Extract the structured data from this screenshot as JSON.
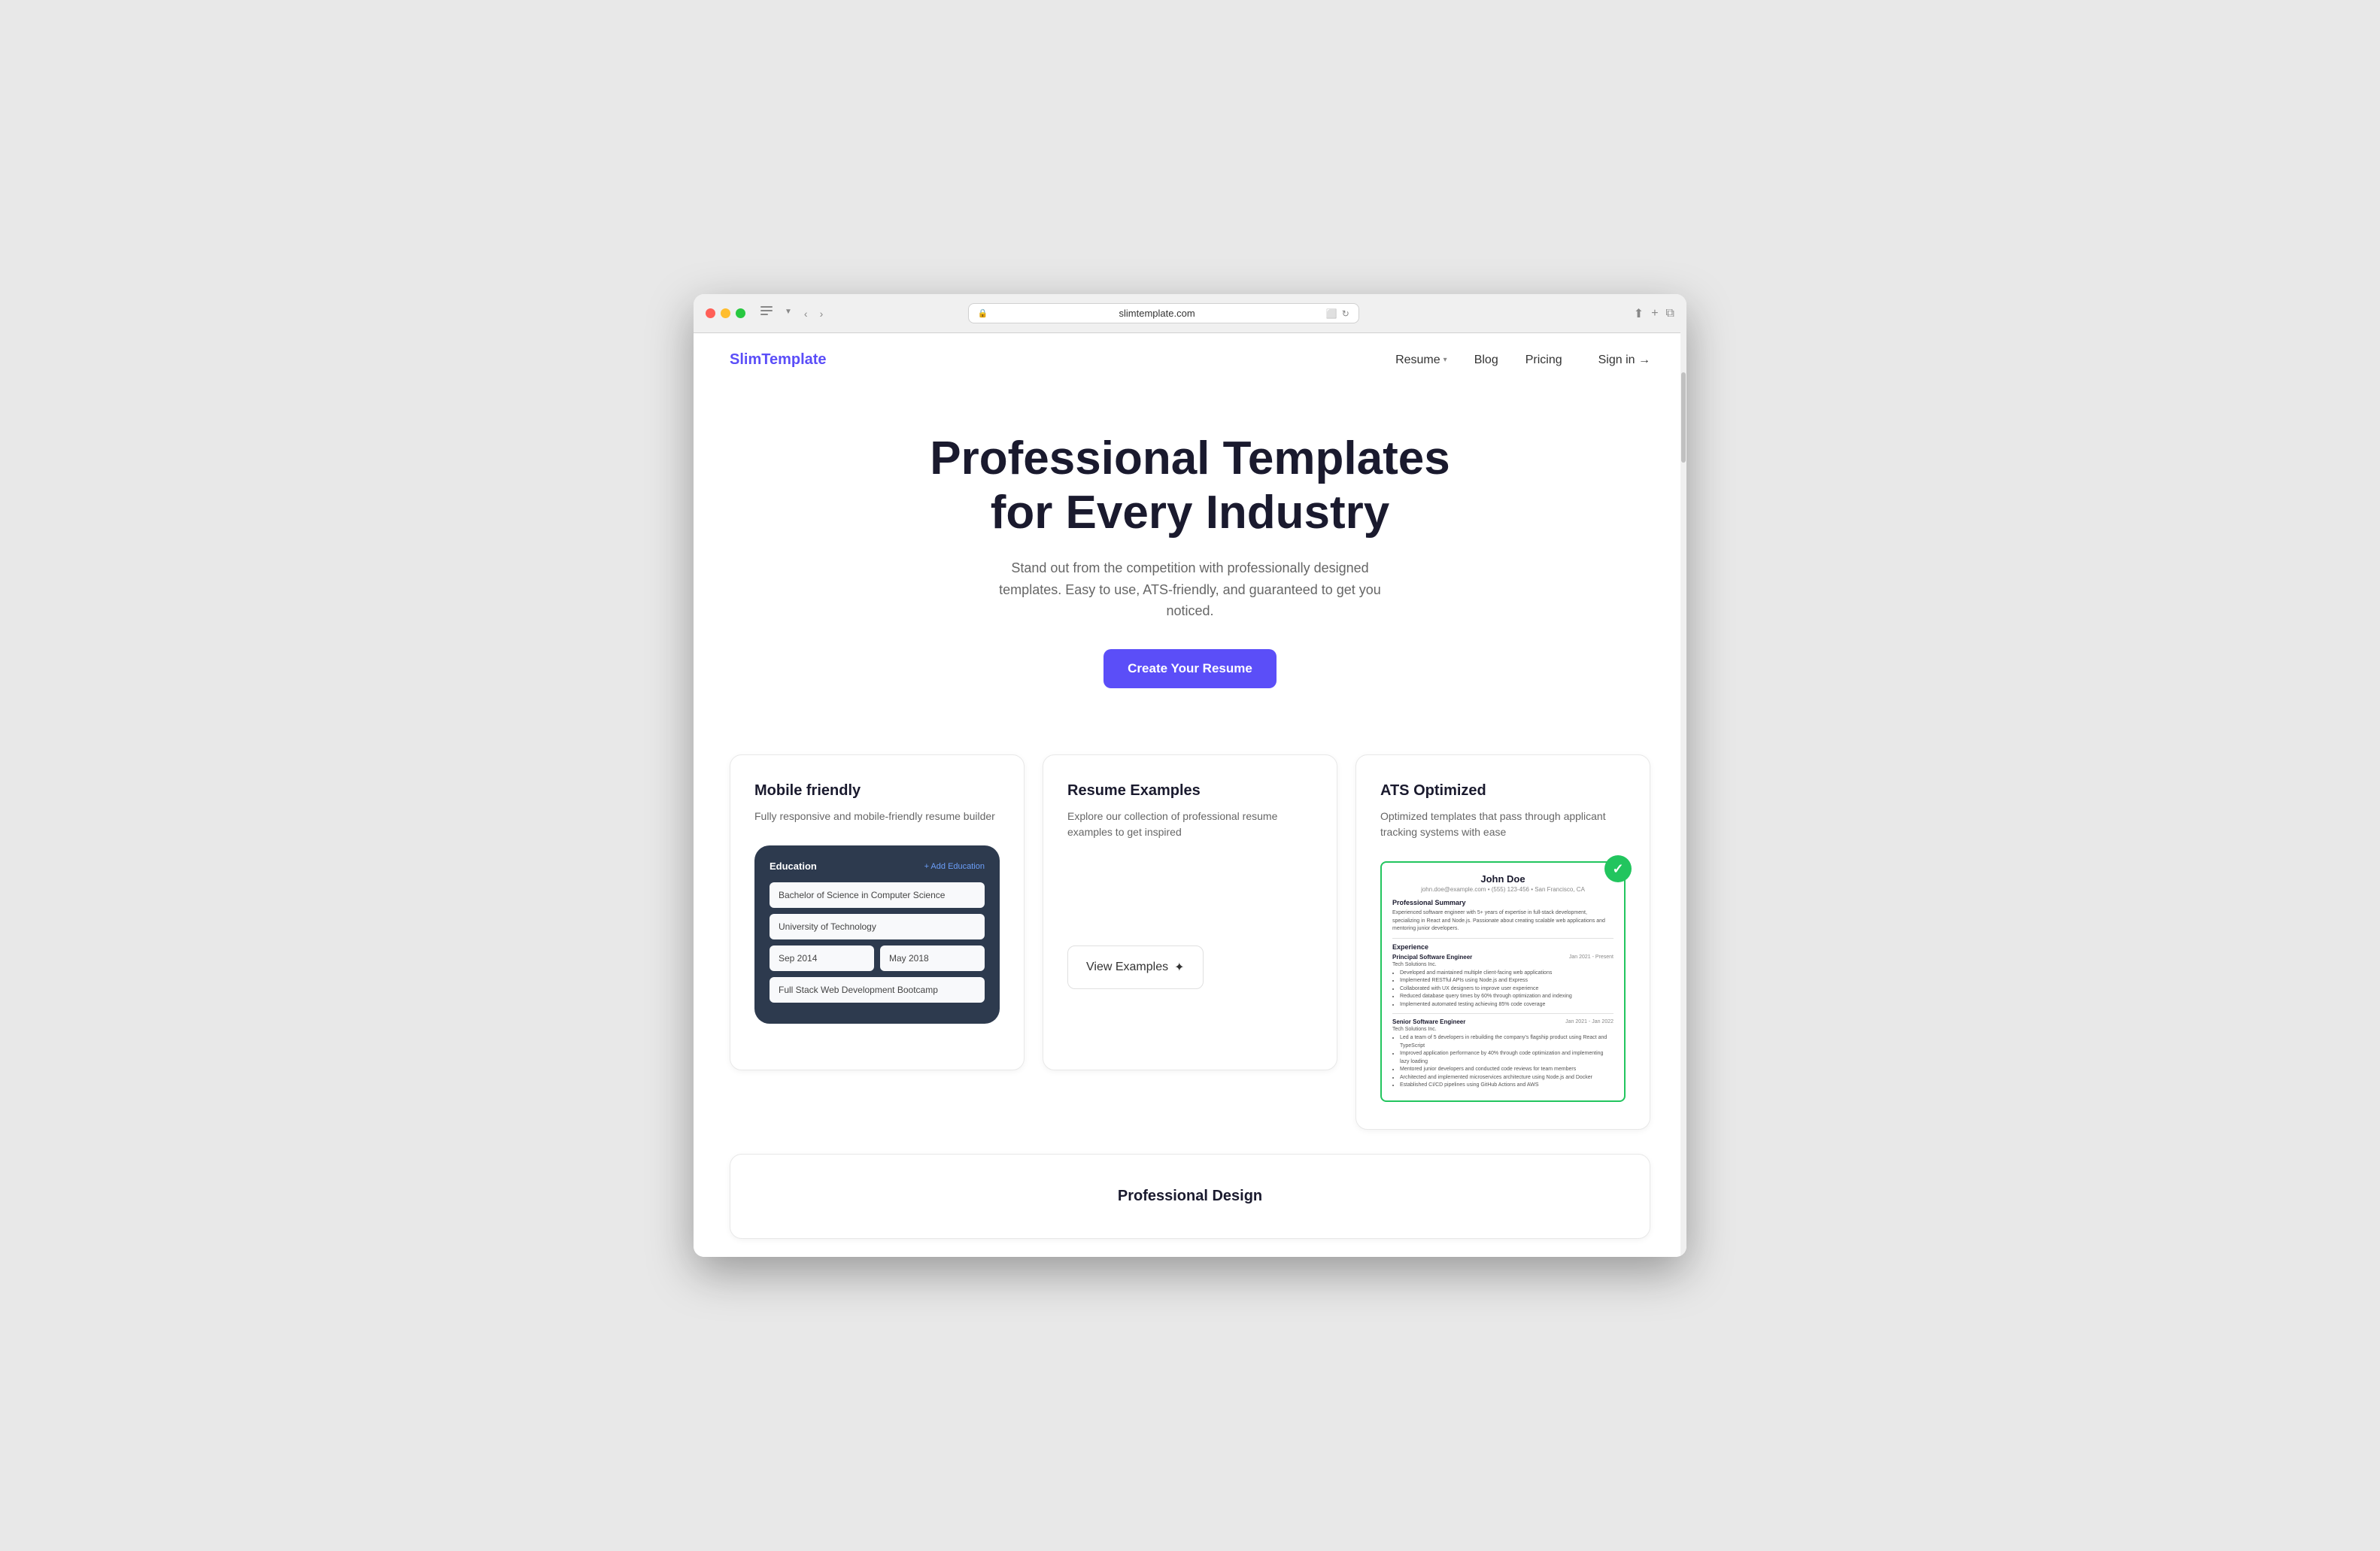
{
  "browser": {
    "url": "slimtemplate.com",
    "traffic_lights": [
      "red",
      "yellow",
      "green"
    ]
  },
  "nav": {
    "logo": "SlimTemplate",
    "links": [
      {
        "label": "Resume",
        "has_dropdown": true
      },
      {
        "label": "Blog",
        "has_dropdown": false
      },
      {
        "label": "Pricing",
        "has_dropdown": false
      }
    ],
    "signin": "Sign in →"
  },
  "hero": {
    "title": "Professional Templates for Every Industry",
    "subtitle": "Stand out from the competition with professionally designed templates. Easy to use, ATS-friendly, and guaranteed to get you noticed.",
    "cta": "Create Your Resume"
  },
  "cards": [
    {
      "id": "mobile-friendly",
      "title": "Mobile friendly",
      "desc": "Fully responsive and mobile-friendly resume builder",
      "form": {
        "section": "Education",
        "add_btn": "+ Add Education",
        "fields": [
          {
            "value": "Bachelor of Science in Computer Science"
          },
          {
            "value": "University of Technology"
          },
          {
            "date_start": "Sep 2014",
            "date_end": "May 2018"
          },
          {
            "value": "Full Stack Web Development Bootcamp"
          }
        ]
      }
    },
    {
      "id": "resume-examples",
      "title": "Resume Examples",
      "desc": "Explore our collection of professional resume examples to get inspired",
      "view_btn": "View Examples",
      "sparkle": "✦"
    },
    {
      "id": "ats-optimized",
      "title": "ATS Optimized",
      "desc": "Optimized templates that pass through applicant tracking systems with ease",
      "resume": {
        "name": "John Doe",
        "contact": "john.doe@example.com • (555) 123-456 • San Francisco, CA",
        "summary_title": "Professional Summary",
        "summary": "Experienced software engineer with 5+ years of expertise in full-stack development, specializing in React and Node.js. Passionate about creating scalable web applications and mentoring junior developers.",
        "experience_title": "Experience",
        "jobs": [
          {
            "title": "Principal Software Engineer",
            "company": "Tech Solutions Inc.",
            "dates": "Jan 2021 - Present",
            "bullets": [
              "Developed and maintained multiple client-facing web applications",
              "Implemented RESTful APIs using Node.js and Express",
              "Collaborated with UX designers to improve user experience",
              "Reduced database query times by 60% through optimization and indexing",
              "Implemented automated testing achieving 85% code coverage"
            ]
          },
          {
            "title": "Senior Software Engineer",
            "company": "Tech Solutions Inc.",
            "dates": "Jan 2021 - Jan 2022",
            "bullets": [
              "Led a team of 5 developers in rebuilding the company's flagship product using React and TypeScript",
              "Improved application performance by 40% through code optimization and implementing lazy loading",
              "Mentored junior developers and conducted code reviews for team members",
              "Architected and implemented microservices architecture using Node.js and Docker",
              "Established CI/CD pipelines using GitHub Actions and AWS"
            ]
          }
        ]
      }
    }
  ],
  "bottom_card": {
    "title": "Professional Design"
  }
}
